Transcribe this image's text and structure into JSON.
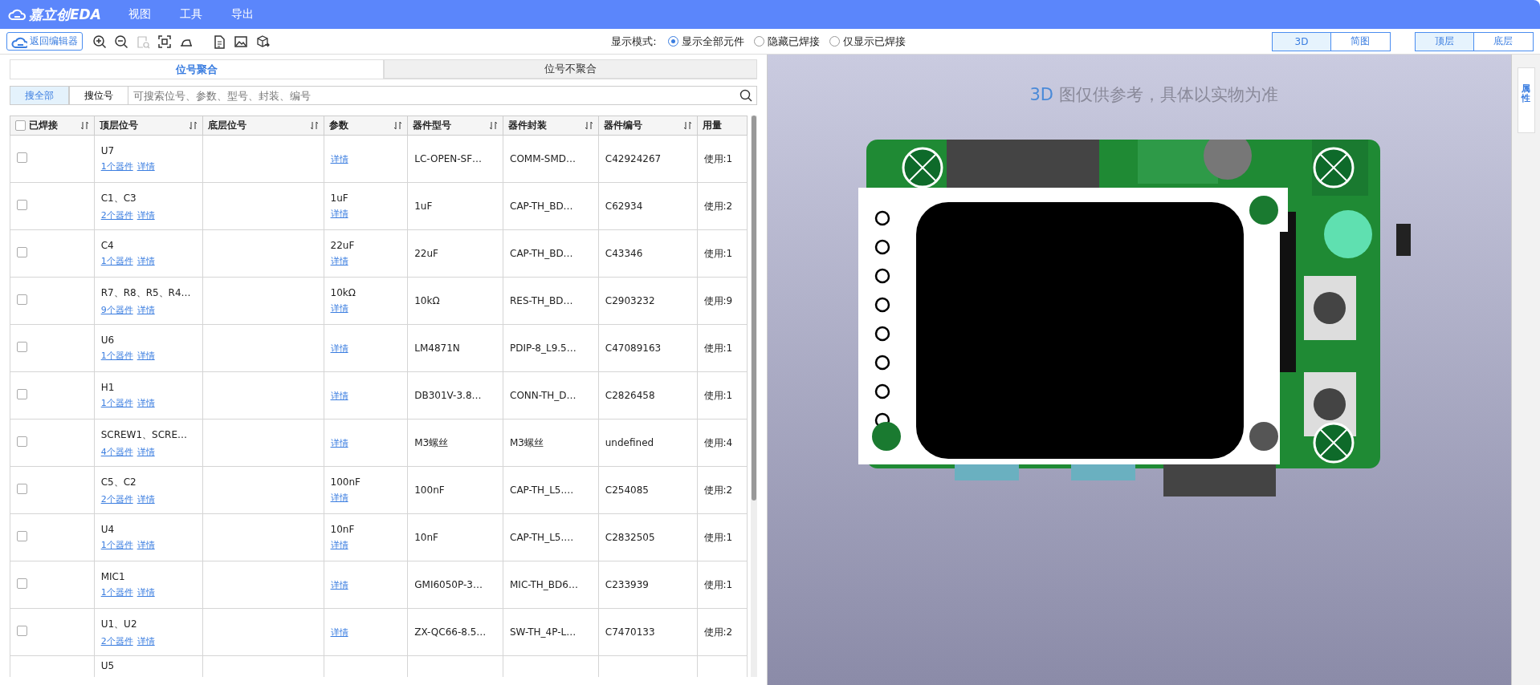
{
  "app": {
    "logo": "嘉立创EDA",
    "menu": [
      {
        "label": "视图"
      },
      {
        "label": "工具"
      },
      {
        "label": "导出"
      }
    ]
  },
  "toolbar": {
    "back_button": "返回编辑器",
    "tools": [
      {
        "kind": "zoom-in",
        "disabled": false
      },
      {
        "kind": "zoom-out",
        "disabled": false
      },
      {
        "kind": "zoom-area",
        "disabled": true
      },
      {
        "kind": "fit",
        "disabled": false
      },
      {
        "kind": "iron",
        "disabled": false
      },
      {
        "kind": "bom",
        "disabled": false
      },
      {
        "kind": "image",
        "disabled": false
      },
      {
        "kind": "export",
        "disabled": false
      }
    ],
    "display_mode": {
      "label": "显示模式:",
      "options": [
        {
          "label": "显示全部元件",
          "selected": true
        },
        {
          "label": "隐藏已焊接",
          "selected": false
        },
        {
          "label": "仅显示已焊接",
          "selected": false
        }
      ]
    },
    "view_toggle": [
      {
        "label": "3D",
        "selected": true
      },
      {
        "label": "简图",
        "selected": false
      }
    ],
    "layer_toggle": [
      {
        "label": "顶层",
        "selected": true
      },
      {
        "label": "底层",
        "selected": false
      }
    ]
  },
  "left_panel": {
    "tabs": [
      {
        "label": "位号聚合",
        "selected": true
      },
      {
        "label": "位号不聚合",
        "selected": false
      }
    ],
    "search_modes": [
      {
        "label": "搜全部",
        "selected": true
      },
      {
        "label": "搜位号",
        "selected": false
      }
    ],
    "search": {
      "placeholder": "可搜索位号、参数、型号、封装、编号"
    },
    "table": {
      "header_checked": false,
      "columns": [
        {
          "label": "已焊接",
          "sortable": true
        },
        {
          "label": "顶层位号",
          "sortable": true
        },
        {
          "label": "底层位号",
          "sortable": true
        },
        {
          "label": "参数",
          "sortable": true
        },
        {
          "label": "器件型号",
          "sortable": true
        },
        {
          "label": "器件封装",
          "sortable": true
        },
        {
          "label": "器件编号",
          "sortable": true
        },
        {
          "label": "用量",
          "sortable": false
        }
      ],
      "rows": [
        {
          "checked": false,
          "top": "U7",
          "count_link": "1个器件",
          "detail_link": "详情",
          "param_link": "详情",
          "model": "LC-OPEN-SF…",
          "package": "COMM-SMD…",
          "code": "C42924267",
          "usage": "使用:1"
        },
        {
          "checked": false,
          "top": "C1、C3",
          "count_link": "2个器件",
          "detail_link": "详情",
          "param": "1uF",
          "param_link": "详情",
          "model": "1uF",
          "package": "CAP-TH_BD…",
          "code": "C62934",
          "usage": "使用:2"
        },
        {
          "checked": false,
          "top": "C4",
          "count_link": "1个器件",
          "detail_link": "详情",
          "param": "22uF",
          "param_link": "详情",
          "model": "22uF",
          "package": "CAP-TH_BD…",
          "code": "C43346",
          "usage": "使用:1"
        },
        {
          "checked": false,
          "top": "R7、R8、R5、R4…",
          "count_link": "9个器件",
          "detail_link": "详情",
          "param": "10kΩ",
          "param_link": "详情",
          "model": "10kΩ",
          "package": "RES-TH_BD…",
          "code": "C2903232",
          "usage": "使用:9"
        },
        {
          "checked": false,
          "top": "U6",
          "count_link": "1个器件",
          "detail_link": "详情",
          "param_link": "详情",
          "model": "LM4871N",
          "package": "PDIP-8_L9.5…",
          "code": "C47089163",
          "usage": "使用:1"
        },
        {
          "checked": false,
          "top": "H1",
          "count_link": "1个器件",
          "detail_link": "详情",
          "param_link": "详情",
          "model": "DB301V-3.8…",
          "package": "CONN-TH_D…",
          "code": "C2826458",
          "usage": "使用:1"
        },
        {
          "checked": false,
          "top": "SCREW1、SCRE…",
          "count_link": "4个器件",
          "detail_link": "详情",
          "param_link": "详情",
          "model": "M3螺丝",
          "package": "M3螺丝",
          "code": "undefined",
          "usage": "使用:4"
        },
        {
          "checked": false,
          "top": "C5、C2",
          "count_link": "2个器件",
          "detail_link": "详情",
          "param": "100nF",
          "param_link": "详情",
          "model": "100nF",
          "package": "CAP-TH_L5.…",
          "code": "C254085",
          "usage": "使用:2"
        },
        {
          "checked": false,
          "top": "U4",
          "count_link": "1个器件",
          "detail_link": "详情",
          "param": "10nF",
          "param_link": "详情",
          "model": "10nF",
          "package": "CAP-TH_L5.…",
          "code": "C2832505",
          "usage": "使用:1"
        },
        {
          "checked": false,
          "top": "MIC1",
          "count_link": "1个器件",
          "detail_link": "详情",
          "param_link": "详情",
          "model": "GMI6050P-3…",
          "package": "MIC-TH_BD6…",
          "code": "C233939",
          "usage": "使用:1"
        },
        {
          "checked": false,
          "top": "U1、U2",
          "count_link": "2个器件",
          "detail_link": "详情",
          "param_link": "详情",
          "model": "ZX-QC66-8.5…",
          "package": "SW-TH_4P-L…",
          "code": "C7470133",
          "usage": "使用:2"
        },
        {
          "top": "U5"
        }
      ]
    }
  },
  "viewer": {
    "notice_highlight": "3D",
    "notice": "图仅供参考，具体以实物为准",
    "side_tab": "属性"
  }
}
